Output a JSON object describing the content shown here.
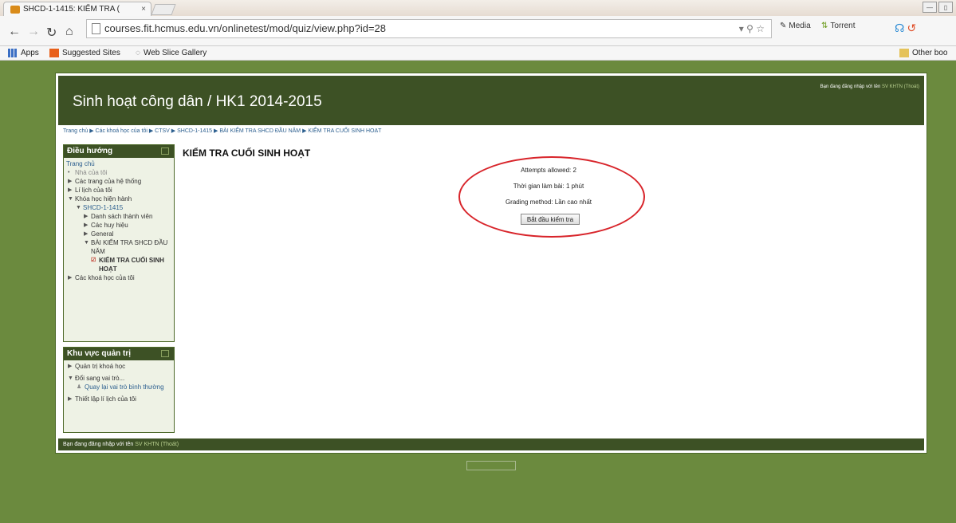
{
  "browser": {
    "tab_title": "SHCD-1-1415: KIỂM TRA (",
    "tab_close": "×",
    "url": "courses.fit.hcmus.edu.vn/onlinetest/mod/quiz/view.php?id=28",
    "extensions": {
      "media": "Media",
      "torrent": "Torrent"
    },
    "bookmarks": {
      "apps": "Apps",
      "suggested": "Suggested Sites",
      "webslice": "Web Slice Gallery",
      "other": "Other boo"
    }
  },
  "page": {
    "site_title": "Sinh hoạt công dân / HK1 2014-2015",
    "login_text": "Bạn đang đăng nhập với tên",
    "login_user": "SV KHTN",
    "login_logout": "(Thoát)",
    "breadcrumb": "Trang chủ ▶ Các khoá học của tôi ▶ CTSV ▶ SHCD-1-1415 ▶ BÀI KIỂM TRA SHCD ĐẦU NĂM ▶ KIỂM TRA CUỐI SINH HOẠT"
  },
  "nav_block": {
    "title": "Điều hướng",
    "items": [
      "Trang chủ",
      "Nhà của tôi",
      "Các trang của hệ thống",
      "Lí lịch của tôi",
      "Khóa học hiện hành",
      "SHCD-1-1415",
      "Danh sách thành viên",
      "Các huy hiệu",
      "General",
      "BÀI KIỂM TRA SHCD ĐẦU NĂM",
      "KIỂM TRA CUỐI SINH HOẠT",
      "Các khoá học của tôi"
    ]
  },
  "admin_block": {
    "title": "Khu vực quản trị",
    "items": [
      "Quản trị khoá học",
      "Đổi sang vai trò...",
      "Quay lại vai trò bình thường",
      "Thiết lập lí lịch của tôi"
    ]
  },
  "quiz": {
    "title": "KIỂM TRA CUỐI SINH HOẠT",
    "attempts": "Attempts allowed: 2",
    "time": "Thời gian làm bài: 1 phút",
    "grading": "Grading method: Lần cao nhất",
    "start_button": "Bắt đầu kiểm tra"
  },
  "footer": {
    "login_text": "Bạn đang đăng nhập với tên",
    "login_user": "SV KHTN",
    "login_logout": "(Thoát)"
  },
  "colors": {
    "background": "#6b8a3e",
    "header": "#3d5125",
    "link": "#2c5f8f",
    "annotation": "#d8242a"
  }
}
